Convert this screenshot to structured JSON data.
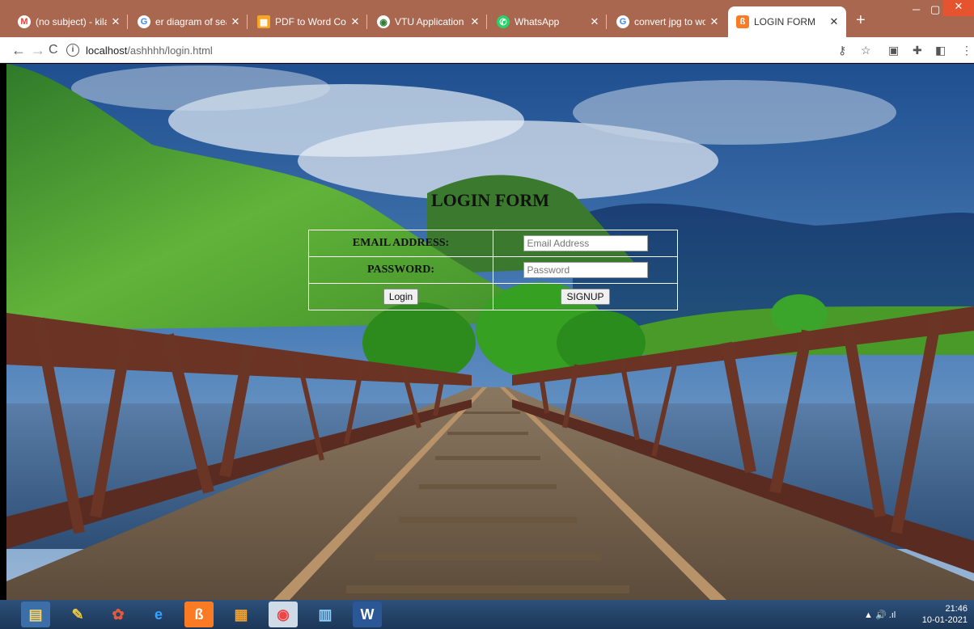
{
  "tabs": [
    {
      "title": "(no subject) - kilana",
      "icon": "gmail-icon",
      "color": "#ea4335"
    },
    {
      "title": "er diagram of searc",
      "icon": "google-icon",
      "color": "#4285f4"
    },
    {
      "title": "PDF to Word Conve",
      "icon": "pdf-converter-icon",
      "color": "#f5a623"
    },
    {
      "title": "VTU Application",
      "icon": "vtu-icon",
      "color": "#2e7d32"
    },
    {
      "title": "WhatsApp",
      "icon": "whatsapp-icon",
      "color": "#25d366"
    },
    {
      "title": "convert jpg to word",
      "icon": "google-icon",
      "color": "#4285f4"
    },
    {
      "title": "LOGIN FORM",
      "icon": "xampp-icon",
      "color": "#fb7a24"
    }
  ],
  "address": {
    "host": "localhost",
    "path": "/ashhhh/login.html"
  },
  "form": {
    "title": "LOGIN FORM",
    "email_label": "EMAIL ADDRESS:",
    "email_placeholder": "Email Address",
    "password_label": "PASSWORD:",
    "password_placeholder": "Password",
    "login_label": "Login",
    "signup_label": "SIGNUP"
  },
  "taskbar": {
    "apps": [
      "file-explorer-icon",
      "notes-icon",
      "paint-icon",
      "internet-explorer-icon",
      "xampp-icon",
      "calculator-icon",
      "chrome-icon",
      "control-panel-icon",
      "word-icon"
    ],
    "time": "21:46",
    "date": "10-01-2021"
  }
}
